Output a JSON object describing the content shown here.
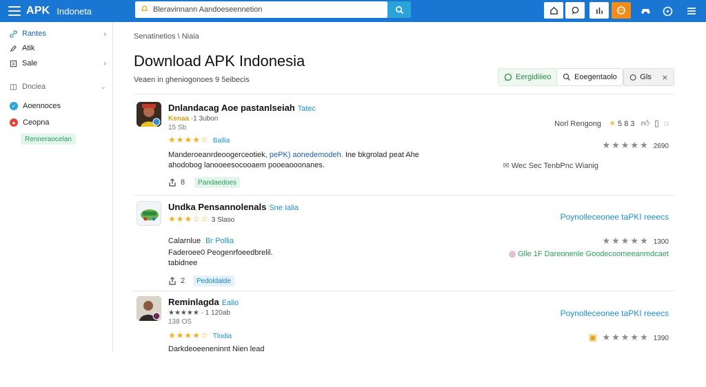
{
  "header": {
    "brand": "APK",
    "brand_sub": "Indoneta",
    "search_placeholder": "Bleravinnann Aandoeseennetion"
  },
  "sidebar": {
    "items": [
      {
        "label": "Rantes",
        "icon": "link-icon"
      },
      {
        "label": "Atik",
        "icon": "pencil-icon"
      },
      {
        "label": "Sale",
        "icon": "list-icon"
      },
      {
        "label": "Dnciea",
        "icon": "grid-icon"
      },
      {
        "label": "Aoennoces",
        "icon": "check-icon"
      },
      {
        "label": "Ceopna",
        "icon": "record-icon"
      }
    ],
    "badge": "Renneraocelan",
    "colors": {
      "check": "#29a3d8",
      "record": "#e0443a"
    }
  },
  "main": {
    "breadcrumb": "Senatinetios \\ Niaia",
    "title": "Download APK Indonesia",
    "subtitle": "Veaen in gheniogonoes 9 5eibecis",
    "chips": {
      "green": "Eergidiiieo",
      "search": "Eoegentaolo",
      "grey": "Gls"
    }
  },
  "apps": [
    {
      "name": "Dnlandacag Aoe pastanlseiah",
      "tag": "Tatec",
      "meta1_hl": "Kenaa",
      "meta1": "·1 3ubon",
      "meta2": "15 Sb",
      "stars": "★★★★☆",
      "rating_text": "Ballia",
      "desc1": "Manderoeanrdeoogerceotiek,",
      "desc_blue": "pePK) aonedemodeh.",
      "desc1b": "Ine bkgrolad peat Ahe",
      "desc2": "ahodobog lanooeesocooaem pooeaooonanes.",
      "share": "8",
      "badge": "Pandaedoes",
      "right1": "Norl Rengong",
      "right1b": "5 8 3",
      "right_stars": "★★★★★",
      "right_val": "2690",
      "right3": "Wec Sec TenbPnc Wianig"
    },
    {
      "name": "Undka Pensannolenals",
      "tag": "Sne Ialia",
      "meta1_hl": "",
      "meta1": "",
      "meta2": "",
      "stars": "★★★☆☆",
      "stars_num": "3 Slaso",
      "line2_a": "Calarnlue",
      "line2_b": "Br Pollia",
      "desc1": "Faderoee0 Peogenrfoeedbrelil.",
      "desc2": "tabidnee",
      "share": "2",
      "badge": "Pedoldalde",
      "right1": "Poynolleceonee taPKI reeecs",
      "right_stars": "★★★★★",
      "right_val": "1300",
      "right3": "Glle 1F Dareonenle Goodecoomeeanmdcaet"
    },
    {
      "name": "Reminlagda",
      "tag": "Ealio",
      "meta1": "★★★★★ · 1 120ab",
      "meta2": "138 OS",
      "stars": "★★★★☆",
      "rating_text": "Tlodia",
      "desc1": "Darkdeoeeneninnt Nien lead",
      "right1": "Poynolleceonee taPKI reeecs",
      "right_stars": "★★★★★",
      "right_val": "1390"
    }
  ]
}
